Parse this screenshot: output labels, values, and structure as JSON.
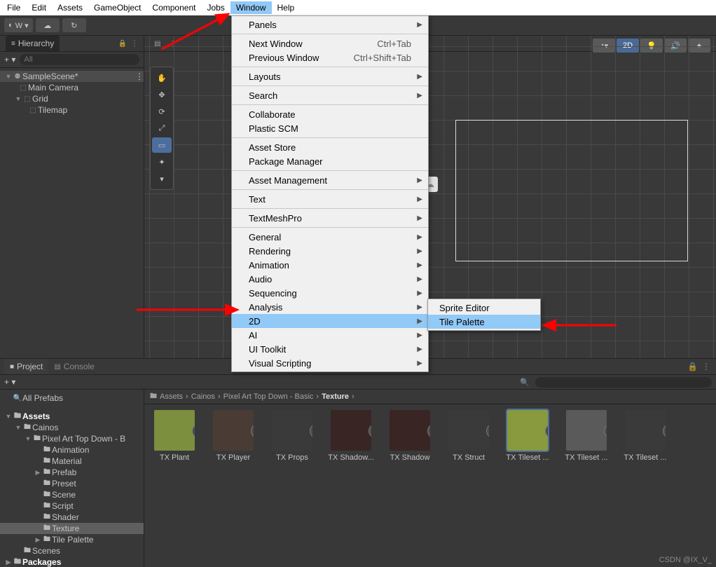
{
  "menubar": {
    "items": [
      "File",
      "Edit",
      "Assets",
      "GameObject",
      "Component",
      "Jobs",
      "Window",
      "Help"
    ],
    "open_index": 6
  },
  "toolbar": {
    "account": "W ▾",
    "play": "▶",
    "pause": "II",
    "step": "▶|"
  },
  "hierarchy": {
    "title": "Hierarchy",
    "search_placeholder": "All",
    "scene": "SampleScene*",
    "items": [
      "Main Camera",
      "Grid",
      "Tilemap"
    ]
  },
  "scene_top": {
    "btn2d": "2D"
  },
  "window_menu": {
    "groups": [
      [
        {
          "label": "Panels",
          "sub": true
        }
      ],
      [
        {
          "label": "Next Window",
          "shortcut": "Ctrl+Tab"
        },
        {
          "label": "Previous Window",
          "shortcut": "Ctrl+Shift+Tab"
        }
      ],
      [
        {
          "label": "Layouts",
          "sub": true
        }
      ],
      [
        {
          "label": "Search",
          "sub": true
        }
      ],
      [
        {
          "label": "Collaborate"
        },
        {
          "label": "Plastic SCM"
        }
      ],
      [
        {
          "label": "Asset Store"
        },
        {
          "label": "Package Manager"
        }
      ],
      [
        {
          "label": "Asset Management",
          "sub": true
        }
      ],
      [
        {
          "label": "Text",
          "sub": true
        }
      ],
      [
        {
          "label": "TextMeshPro",
          "sub": true
        }
      ],
      [
        {
          "label": "General",
          "sub": true
        },
        {
          "label": "Rendering",
          "sub": true
        },
        {
          "label": "Animation",
          "sub": true
        },
        {
          "label": "Audio",
          "sub": true
        },
        {
          "label": "Sequencing",
          "sub": true
        },
        {
          "label": "Analysis",
          "sub": true
        },
        {
          "label": "2D",
          "sub": true,
          "selected": true
        },
        {
          "label": "AI",
          "sub": true
        },
        {
          "label": "UI Toolkit",
          "sub": true
        },
        {
          "label": "Visual Scripting",
          "sub": true
        }
      ]
    ]
  },
  "submenu_2d": {
    "items": [
      {
        "label": "Sprite Editor"
      },
      {
        "label": "Tile Palette",
        "selected": true
      }
    ]
  },
  "project": {
    "tabs": [
      "Project",
      "Console"
    ],
    "breadcrumb": [
      "Assets",
      "Cainos",
      "Pixel Art Top Down - Basic",
      "Texture"
    ],
    "search": {
      "placeholder": ""
    },
    "favorites_label": "All Prefabs",
    "tree": [
      {
        "label": "Assets",
        "depth": 0,
        "expanded": true,
        "bold": true
      },
      {
        "label": "Cainos",
        "depth": 1,
        "expanded": true
      },
      {
        "label": "Pixel Art Top Down - B",
        "depth": 2,
        "expanded": true
      },
      {
        "label": "Animation",
        "depth": 3
      },
      {
        "label": "Material",
        "depth": 3
      },
      {
        "label": "Prefab",
        "depth": 3,
        "collapsed": true
      },
      {
        "label": "Preset",
        "depth": 3
      },
      {
        "label": "Scene",
        "depth": 3
      },
      {
        "label": "Script",
        "depth": 3
      },
      {
        "label": "Shader",
        "depth": 3
      },
      {
        "label": "Texture",
        "depth": 3,
        "selected": true
      },
      {
        "label": "Tile Palette",
        "depth": 3,
        "collapsed": true
      },
      {
        "label": "Scenes",
        "depth": 1
      },
      {
        "label": "Packages",
        "depth": 0,
        "collapsed": true,
        "bold": true
      }
    ],
    "assets": [
      {
        "name": "TX Plant",
        "bg": "#7b8f3f"
      },
      {
        "name": "TX Player",
        "bg": "#4a3b35"
      },
      {
        "name": "TX Props",
        "bg": "#3a3a3a"
      },
      {
        "name": "TX Shadow...",
        "bg": "#3a2525"
      },
      {
        "name": "TX Shadow",
        "bg": "#3a2525"
      },
      {
        "name": "TX Struct",
        "bg": "#3a3a3a"
      },
      {
        "name": "TX Tileset ...",
        "bg": "#889a3d",
        "selected": true
      },
      {
        "name": "TX Tileset ...",
        "bg": "#5a5a5a"
      },
      {
        "name": "TX Tileset ...",
        "bg": "#3a3a3a"
      }
    ]
  },
  "watermark": "CSDN @IX_V_"
}
